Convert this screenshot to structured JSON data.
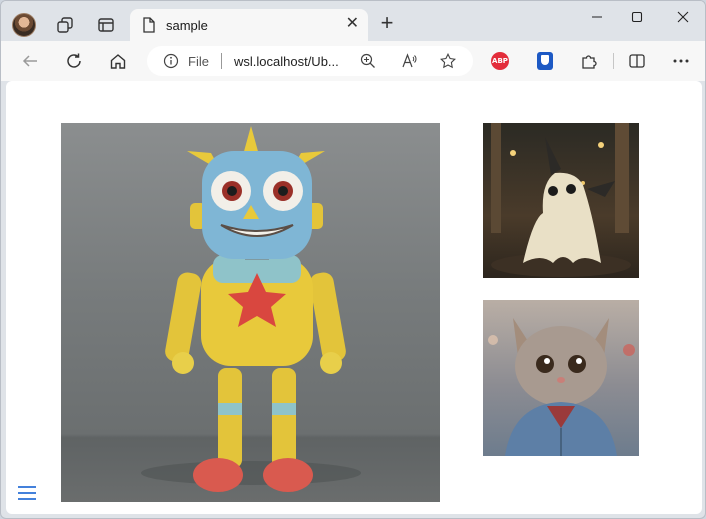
{
  "browser": {
    "tab_title": "sample",
    "address_scheme": "File",
    "address_url": "wsl.localhost/Ub...",
    "abp_label": "ABP"
  },
  "page": {
    "images": [
      {
        "name": "robot-toy-image",
        "icon": "image"
      },
      {
        "name": "mimikyu-figure-image",
        "icon": "image"
      },
      {
        "name": "kitten-jacket-image",
        "icon": "image"
      }
    ],
    "menu_icon": "hamburger-menu-icon"
  },
  "colors": {
    "accent": "#2a6fd6",
    "toolbar_bg": "#f7f7f7",
    "tabstrip_bg": "#dfe3e8",
    "page_bg": "#ffffff"
  }
}
